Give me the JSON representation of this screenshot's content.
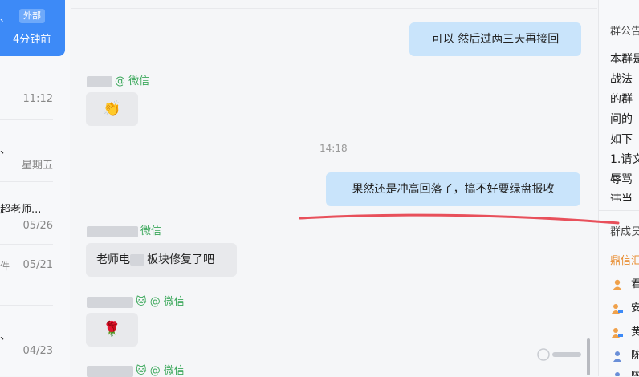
{
  "conversation_list": {
    "active": {
      "tag": "外部",
      "time": "4分钟前",
      "mark": "、"
    },
    "items": [
      {
        "time": "11:12",
        "name": "",
        "sub": ""
      },
      {
        "time": "星期五",
        "name": "",
        "sub": ""
      },
      {
        "time": "05/26",
        "name": "超老师...",
        "sub": ""
      },
      {
        "time": "05/21",
        "name": "",
        "sub": "件"
      },
      {
        "time": "04/23",
        "name": "",
        "sub": ""
      }
    ]
  },
  "chat": {
    "messages": [
      {
        "side": "right",
        "text": "可以  然后过两三天再接回"
      },
      {
        "side": "left",
        "sender_suffix": "@ 微信",
        "content_icon": "clap-emoji"
      },
      {
        "side": "center",
        "text": "14:18"
      },
      {
        "side": "right",
        "text": "果然还是冲高回落了，搞不好要绿盘报收"
      },
      {
        "side": "left",
        "sender_suffix": "微信",
        "text_a": "老师电",
        "text_b": "板块修复了吧"
      },
      {
        "side": "left",
        "sender_suffix": "@ 微信",
        "sender_emoji": "🐱",
        "content_emoji": "🌹"
      },
      {
        "side": "left",
        "sender_suffix": "@ 微信",
        "sender_emoji": "🐱"
      }
    ]
  },
  "group_panel": {
    "announcement_title": "群公告",
    "announcement_lines": [
      "本群是",
      "战法",
      "的群",
      "间的",
      "如下",
      "1.请文",
      "辱骂",
      "违当"
    ],
    "members_title": "群成员",
    "company": "鼎信汇",
    "members": [
      {
        "initial": "君",
        "icon": "person-icon",
        "color": "#f0a14a"
      },
      {
        "initial": "安",
        "icon": "person-pc-icon",
        "color": "#f0a14a"
      },
      {
        "initial": "黄",
        "icon": "person-pc-icon",
        "color": "#f0a14a"
      },
      {
        "initial": "陈",
        "icon": "person-icon",
        "color": "#6a8fd8"
      },
      {
        "initial": "陈",
        "icon": "person-icon",
        "color": "#6a8fd8"
      }
    ]
  },
  "colors": {
    "active_item": "#3d8af7",
    "right_bubble": "#c9e4fb",
    "left_bubble": "#e8e9ec",
    "wechat_green": "#3aa75a",
    "annotation_red": "#e8505b"
  }
}
